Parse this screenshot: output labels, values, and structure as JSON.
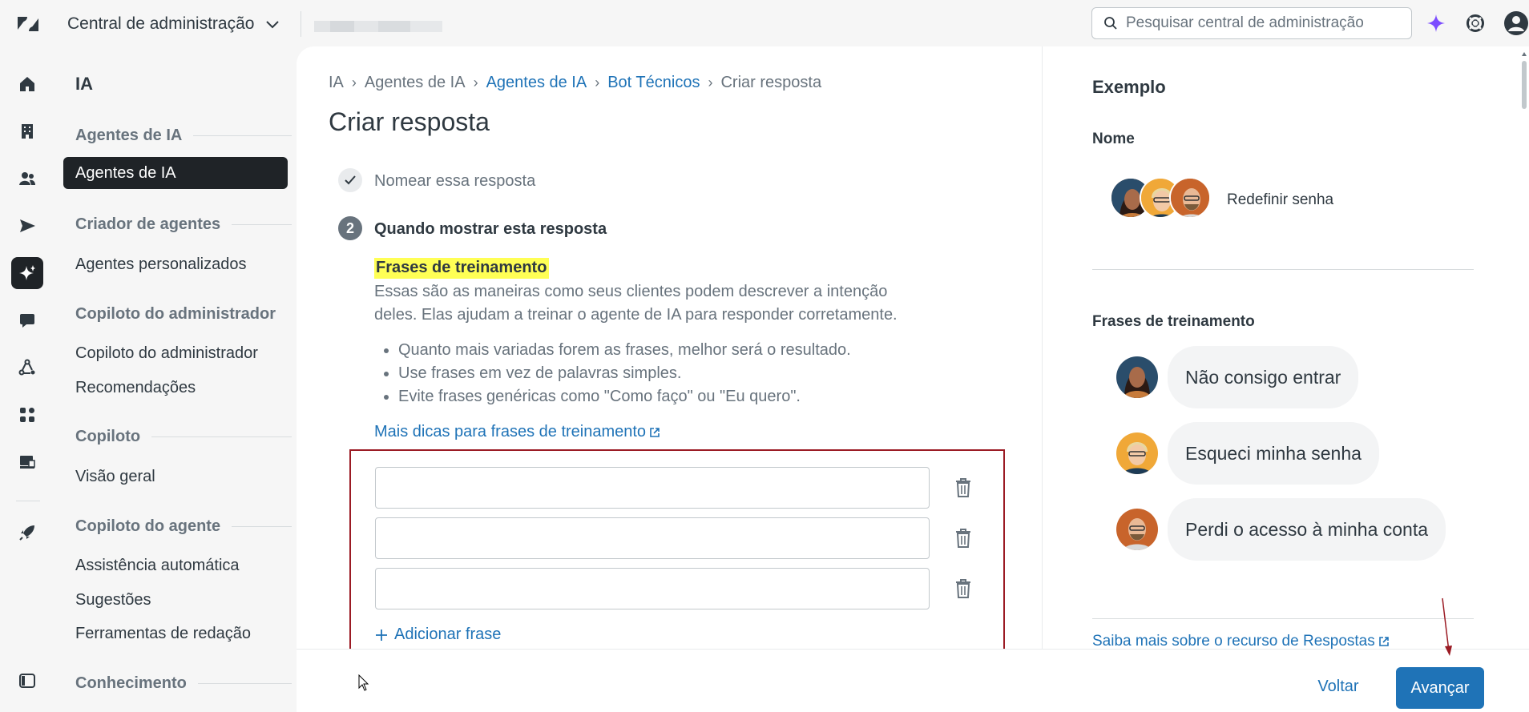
{
  "topbar": {
    "app_title": "Central de administração",
    "search_placeholder": "Pesquisar central de administração",
    "colors": {
      "ai_sparkle": "#7c4dff",
      "brand": "#1f73b7"
    }
  },
  "subnav": {
    "title": "IA",
    "sections": [
      {
        "label": "Agentes de IA",
        "items": [
          "Agentes de IA"
        ]
      },
      {
        "label": "Criador de agentes",
        "items": [
          "Agentes personalizados"
        ]
      },
      {
        "label": "Copiloto do administrador",
        "items": [
          "Copiloto do administrador",
          "Recomendações"
        ]
      },
      {
        "label": "Copiloto",
        "items": [
          "Visão geral"
        ]
      },
      {
        "label": "Copiloto do agente",
        "items": [
          "Assistência automática",
          "Sugestões",
          "Ferramentas de redação"
        ]
      },
      {
        "label": "Conhecimento",
        "items": []
      }
    ]
  },
  "breadcrumb": [
    "IA",
    "Agentes de IA",
    "Agentes de IA",
    "Bot Técnicos",
    "Criar resposta"
  ],
  "page": {
    "title": "Criar resposta",
    "step1": "Nomear essa resposta",
    "step2_num": "2",
    "step2": "Quando mostrar esta resposta",
    "training_title": "Frases de treinamento",
    "description": "Essas são as maneiras como seus clientes podem descrever a intenção deles. Elas ajudam a treinar o agente de IA para responder corretamente.",
    "tips": [
      "Quanto mais variadas forem as frases, melhor será o resultado.",
      "Use frases em vez de palavras simples.",
      "Evite frases genéricas como \"Como faço\" ou \"Eu quero\"."
    ],
    "more_tips": "Mais dicas para frases de treinamento",
    "phrase_inputs": [
      "",
      "",
      ""
    ],
    "add_phrase": "Adicionar frase"
  },
  "footer": {
    "back": "Voltar",
    "next": "Avançar"
  },
  "example": {
    "title": "Exemplo",
    "name_label": "Nome",
    "name_value": "Redefinir senha",
    "phrases_label": "Frases de treinamento",
    "phrases": [
      "Não consigo entrar",
      "Esqueci minha senha",
      "Perdi o acesso à minha conta"
    ],
    "learn_more": "Saiba mais sobre o recurso de Respostas"
  }
}
